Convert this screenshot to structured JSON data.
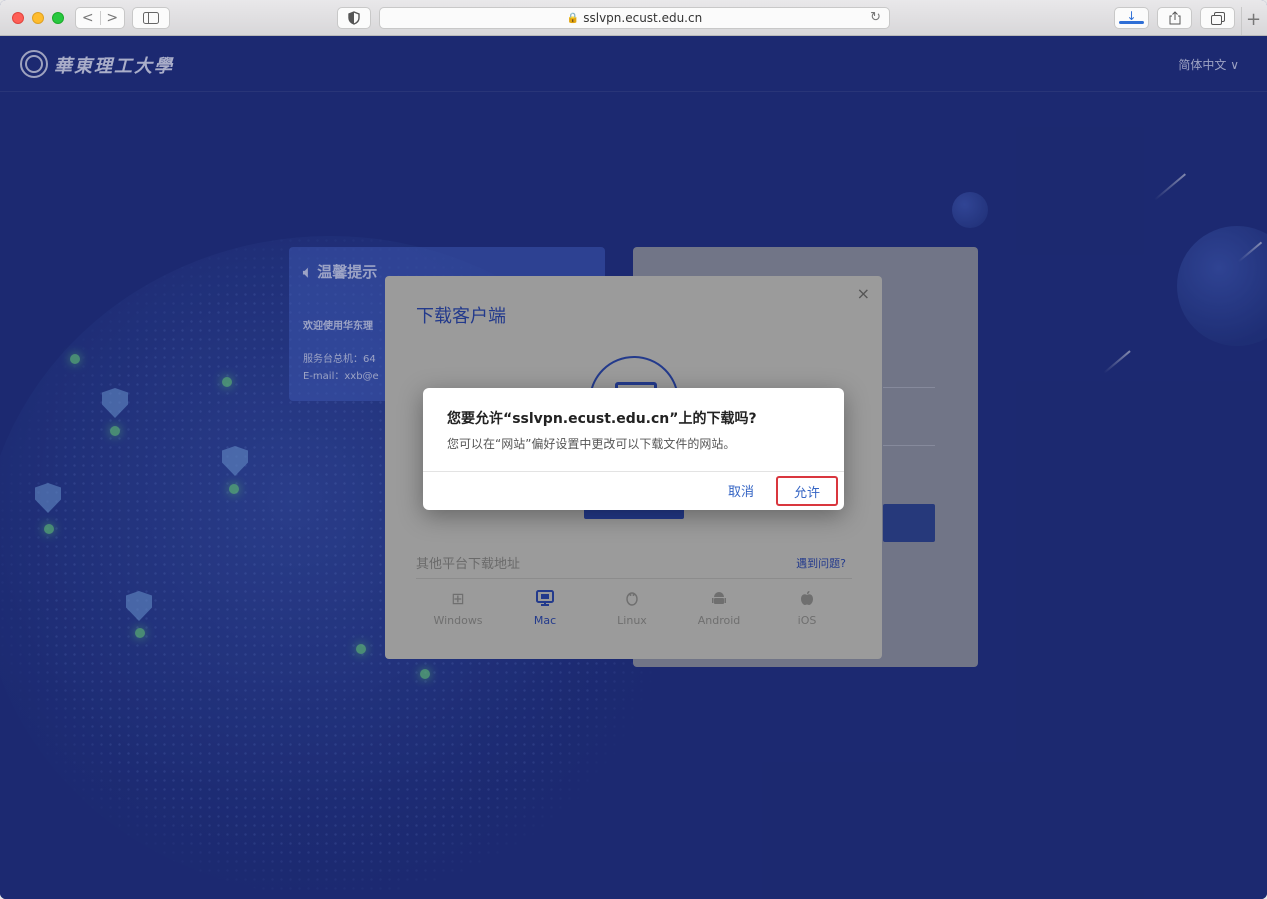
{
  "browser": {
    "url": "sslvpn.ecust.edu.cn",
    "nav_back_icon": "<",
    "nav_forward_icon": ">",
    "new_tab": "+"
  },
  "header": {
    "logo_text": "華東理工大學",
    "language": "简体中文 ∨"
  },
  "notice": {
    "title": "温馨提示",
    "line1": "欢迎使用华东理",
    "line2": "服务台总机：64",
    "line3": "E-mail：xxb@e"
  },
  "download_modal": {
    "title": "下载客户端",
    "close": "×",
    "other_platforms_label": "其他平台下载地址",
    "help_link": "遇到问题?",
    "platforms": [
      {
        "label": "Windows",
        "icon": "windows-icon",
        "glyph": "⊞"
      },
      {
        "label": "Mac",
        "icon": "mac-monitor-icon",
        "glyph": "🖵"
      },
      {
        "label": "Linux",
        "icon": "linux-icon",
        "glyph": "🐧"
      },
      {
        "label": "Android",
        "icon": "android-icon",
        "glyph": "🤖"
      },
      {
        "label": "iOS",
        "icon": "apple-icon",
        "glyph": ""
      }
    ],
    "active_platform": "Mac"
  },
  "alert": {
    "title": "您要允许“sslvpn.ecust.edu.cn”上的下载吗?",
    "message": "您可以在“网站”偏好设置中更改可以下载文件的网站。",
    "cancel_label": "取消",
    "allow_label": "允许"
  },
  "colors": {
    "page_bg": "#1b2a78",
    "accent": "#233a8c",
    "link_blue": "#3464c4",
    "highlight_red": "#d9363e"
  }
}
